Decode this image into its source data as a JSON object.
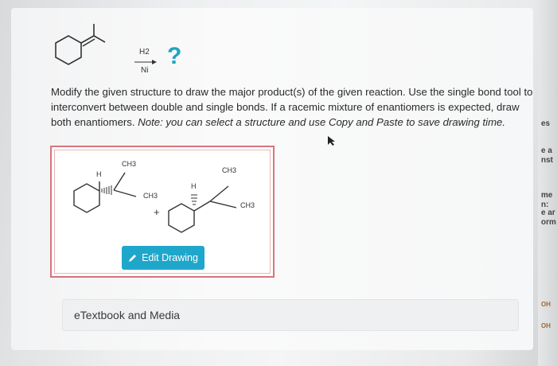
{
  "reaction": {
    "reagent_top": "H2",
    "reagent_bottom": "Ni",
    "question_mark": "?"
  },
  "prompt": {
    "main": "Modify the given structure to draw the major product(s) of the given reaction. Use the single bond tool to interconvert between double and single bonds. If a racemic mixture of enantiomers is expected, draw both enantiomers. ",
    "note": "Note: you can select a structure and use Copy and Paste to save drawing time."
  },
  "drawing": {
    "left_molecule": {
      "h_label": "H",
      "ch3_top": "CH3",
      "ch3_bottom": "CH3"
    },
    "plus": "+",
    "right_molecule": {
      "h_label": "H",
      "ch3_top": "CH3",
      "ch3_right": "CH3"
    },
    "edit_button_label": "Edit Drawing",
    "edit_icon": "pencil-icon"
  },
  "etextbook_label": "eTextbook and Media",
  "right_strip": {
    "fragments": [
      "es",
      "e a",
      "nst",
      "me",
      "n:",
      "e ar",
      "orm",
      "OH",
      "OH"
    ]
  },
  "colors": {
    "accent": "#1fa7cb",
    "question": "#20a3c0",
    "box_border": "#d9747a"
  }
}
